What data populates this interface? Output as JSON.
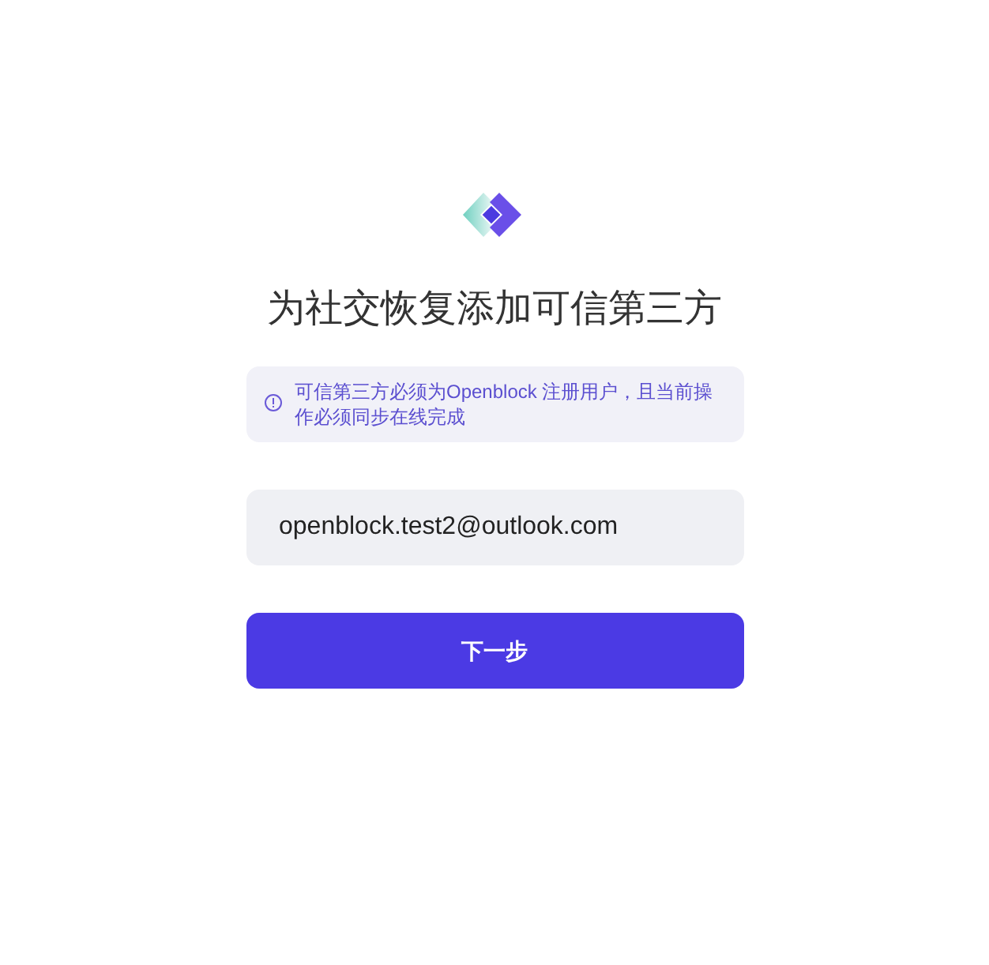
{
  "title": "为社交恢复添加可信第三方",
  "notice": "可信第三方必须为Openblock 注册用户，且当前操作必须同步在线完成",
  "email_field": {
    "value": "openblock.test2@outlook.com"
  },
  "next_button": "下一步"
}
